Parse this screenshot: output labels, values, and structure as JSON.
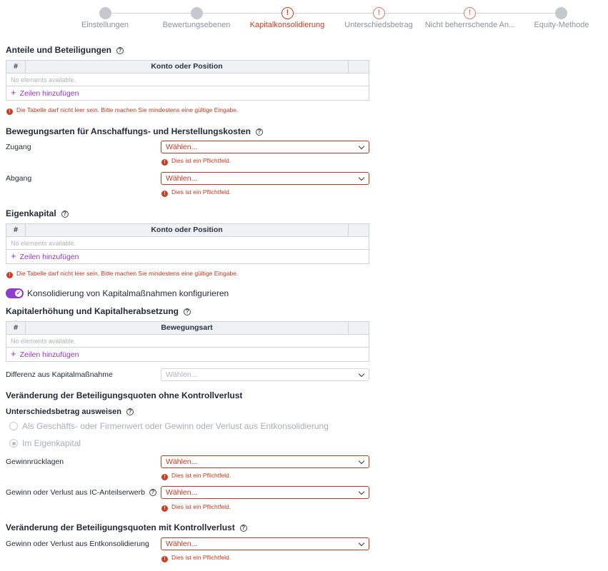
{
  "stepper": {
    "steps": [
      {
        "label": "Einstellungen",
        "state": "done"
      },
      {
        "label": "Bewertungsebenen",
        "state": "done"
      },
      {
        "label": "Kapitalkonsolidierung",
        "state": "active-error"
      },
      {
        "label": "Unterschiedsbetrag",
        "state": "error"
      },
      {
        "label": "Nicht beherrschende An...",
        "state": "error"
      },
      {
        "label": "Equity-Methode",
        "state": "done"
      }
    ],
    "error_glyph": "!"
  },
  "anteile": {
    "title": "Anteile und Beteiligungen",
    "col_num": "#",
    "col_main": "Konto oder Position",
    "empty": "No elements available.",
    "add": "Zeilen hinzufügen",
    "error": "Die Tabelle darf nicht leer sein. Bitte machen Sie mindestens eine gültige Eingabe."
  },
  "bewegungsarten": {
    "title": "Bewegungsarten für Anschaffungs- und Herstellungskosten",
    "zugang_label": "Zugang",
    "zugang_value": "Wählen...",
    "zugang_error": "Dies ist ein Pflichtfeld.",
    "abgang_label": "Abgang",
    "abgang_value": "Wählen...",
    "abgang_error": "Dies ist ein Pflichtfeld."
  },
  "eigenkapital": {
    "title": "Eigenkapital",
    "col_num": "#",
    "col_main": "Konto oder Position",
    "empty": "No elements available.",
    "add": "Zeilen hinzufügen",
    "error": "Die Tabelle darf nicht leer sein. Bitte machen Sie mindestens eine gültige Eingabe."
  },
  "toggle": {
    "label": "Konsolidierung von Kapitalmaßnahmen konfigurieren",
    "on": true,
    "check_glyph": "✓"
  },
  "kapitalerhoehung": {
    "title": "Kapitalerhöhung und Kapitalherabsetzung",
    "col_num": "#",
    "col_main": "Bewegungsart",
    "empty": "No elements available.",
    "add": "Zeilen hinzufügen",
    "differenz_label": "Differenz aus Kapitalmaßnahme",
    "differenz_value": "Wählen..."
  },
  "ohne_kontrollverlust": {
    "title": "Veränderung der Beteiligungsquoten ohne Kontrollverlust",
    "unterschied_label": "Unterschiedsbetrag ausweisen",
    "radio_1": "Als Geschäfts- oder Firmenwert oder Gewinn oder Verlust aus Entkonsolidierung",
    "radio_2": "Im Eigenkapital",
    "selected_radio": "Im Eigenkapital",
    "gewinnruecklagen_label": "Gewinnrücklagen",
    "gewinnruecklagen_value": "Wählen...",
    "gewinnruecklagen_error": "Dies ist ein Pflichtfeld.",
    "ic_label": "Gewinn oder Verlust aus IC-Anteilserwerb",
    "ic_value": "Wählen...",
    "ic_error": "Dies ist ein Pflichtfeld."
  },
  "mit_kontrollverlust": {
    "title": "Veränderung der Beteiligungsquoten mit Kontrollverlust",
    "entkons_label": "Gewinn oder Verlust aus Entkonsolidierung",
    "entkons_value": "Wählen...",
    "entkons_error": "Dies ist ein Pflichtfeld."
  },
  "icons": {
    "help": "?",
    "error": "!",
    "plus": "+"
  },
  "colors": {
    "accent": "#9334c9",
    "error": "#d43a1f",
    "toggle": "#8d3ccc"
  }
}
